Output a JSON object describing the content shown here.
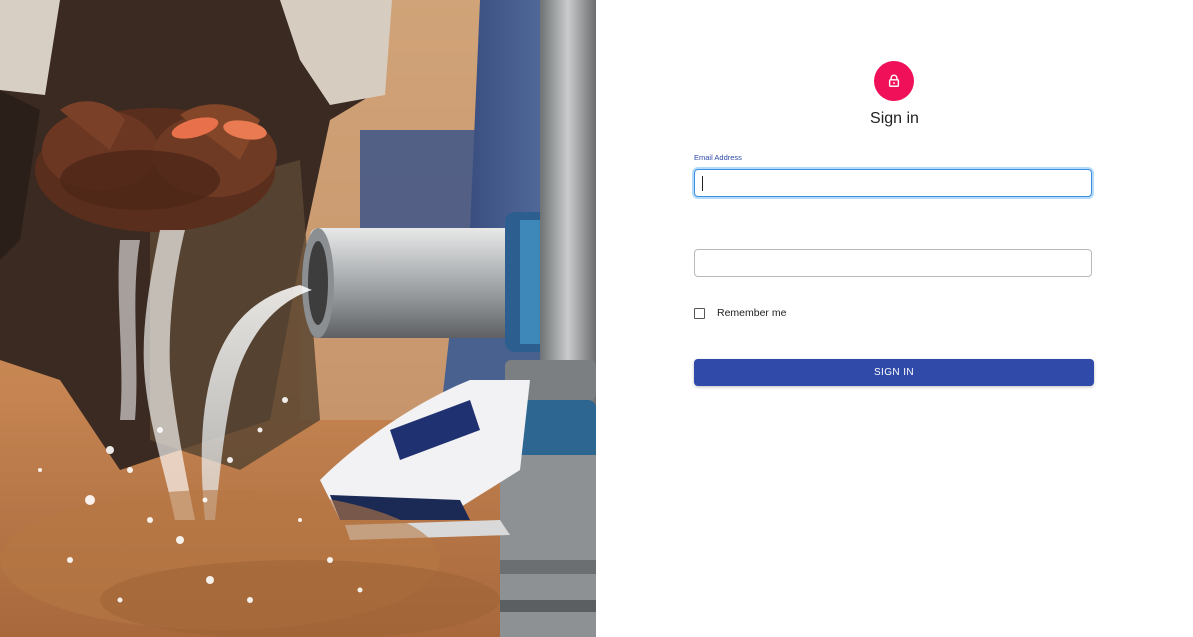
{
  "photo": {
    "alt_icon": "water-pump-photo"
  },
  "signin": {
    "avatar_icon": "lock-icon",
    "title": "Sign in",
    "email_label": "Email Address",
    "email_value": "",
    "password_value": "",
    "remember_label": "Remember me",
    "remember_checked": false,
    "submit_label": "SIGN IN"
  },
  "colors": {
    "avatar_bg": "#f0105a",
    "accent_blue": "#2f4aa8",
    "label_blue": "#2f4aa8",
    "focus_border": "#3f8fe0"
  }
}
